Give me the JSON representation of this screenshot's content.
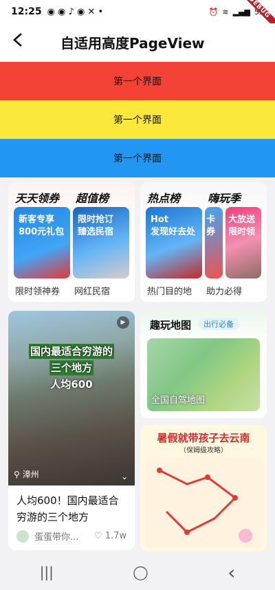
{
  "status": {
    "time": "12:25",
    "debug": "DEBUG",
    "battery": "59"
  },
  "appbar": {
    "title": "自适用高度PageView"
  },
  "pages": [
    "第一个界面",
    "第一个界面",
    "第一个界面"
  ],
  "card1": {
    "header_a": "天天领券",
    "header_b": "超值榜",
    "tile1": "新客专享\n800元礼包",
    "tile2": "限时抢订\n臻选民宿",
    "label1": "限时领神券",
    "label2": "网红民宿"
  },
  "card2": {
    "header_a": "热点榜",
    "header_b": "嗨玩季",
    "tile1": "Hot\n发现好去处",
    "tile2": "卡券",
    "tile3": "大放送\n限时领",
    "label1": "热门目的地",
    "label2": "助力必得"
  },
  "video": {
    "overlay1": "国内最适合穷游的",
    "overlay2": "三个地方",
    "overlay3": "人均600",
    "location": "漳州",
    "title": "人均600！国内最适合穷游的三个地方",
    "author": "蛋蛋带你...",
    "likes": "1.7w"
  },
  "mapcard": {
    "title": "趣玩地图",
    "badge": "出行必备",
    "caption": "全国自驾地图"
  },
  "poster": {
    "title": "暑假就带孩子去云南",
    "subtitle": "（保姆级攻略）"
  },
  "nav": {
    "recent": "|||",
    "home": "◯",
    "back": "‹"
  }
}
